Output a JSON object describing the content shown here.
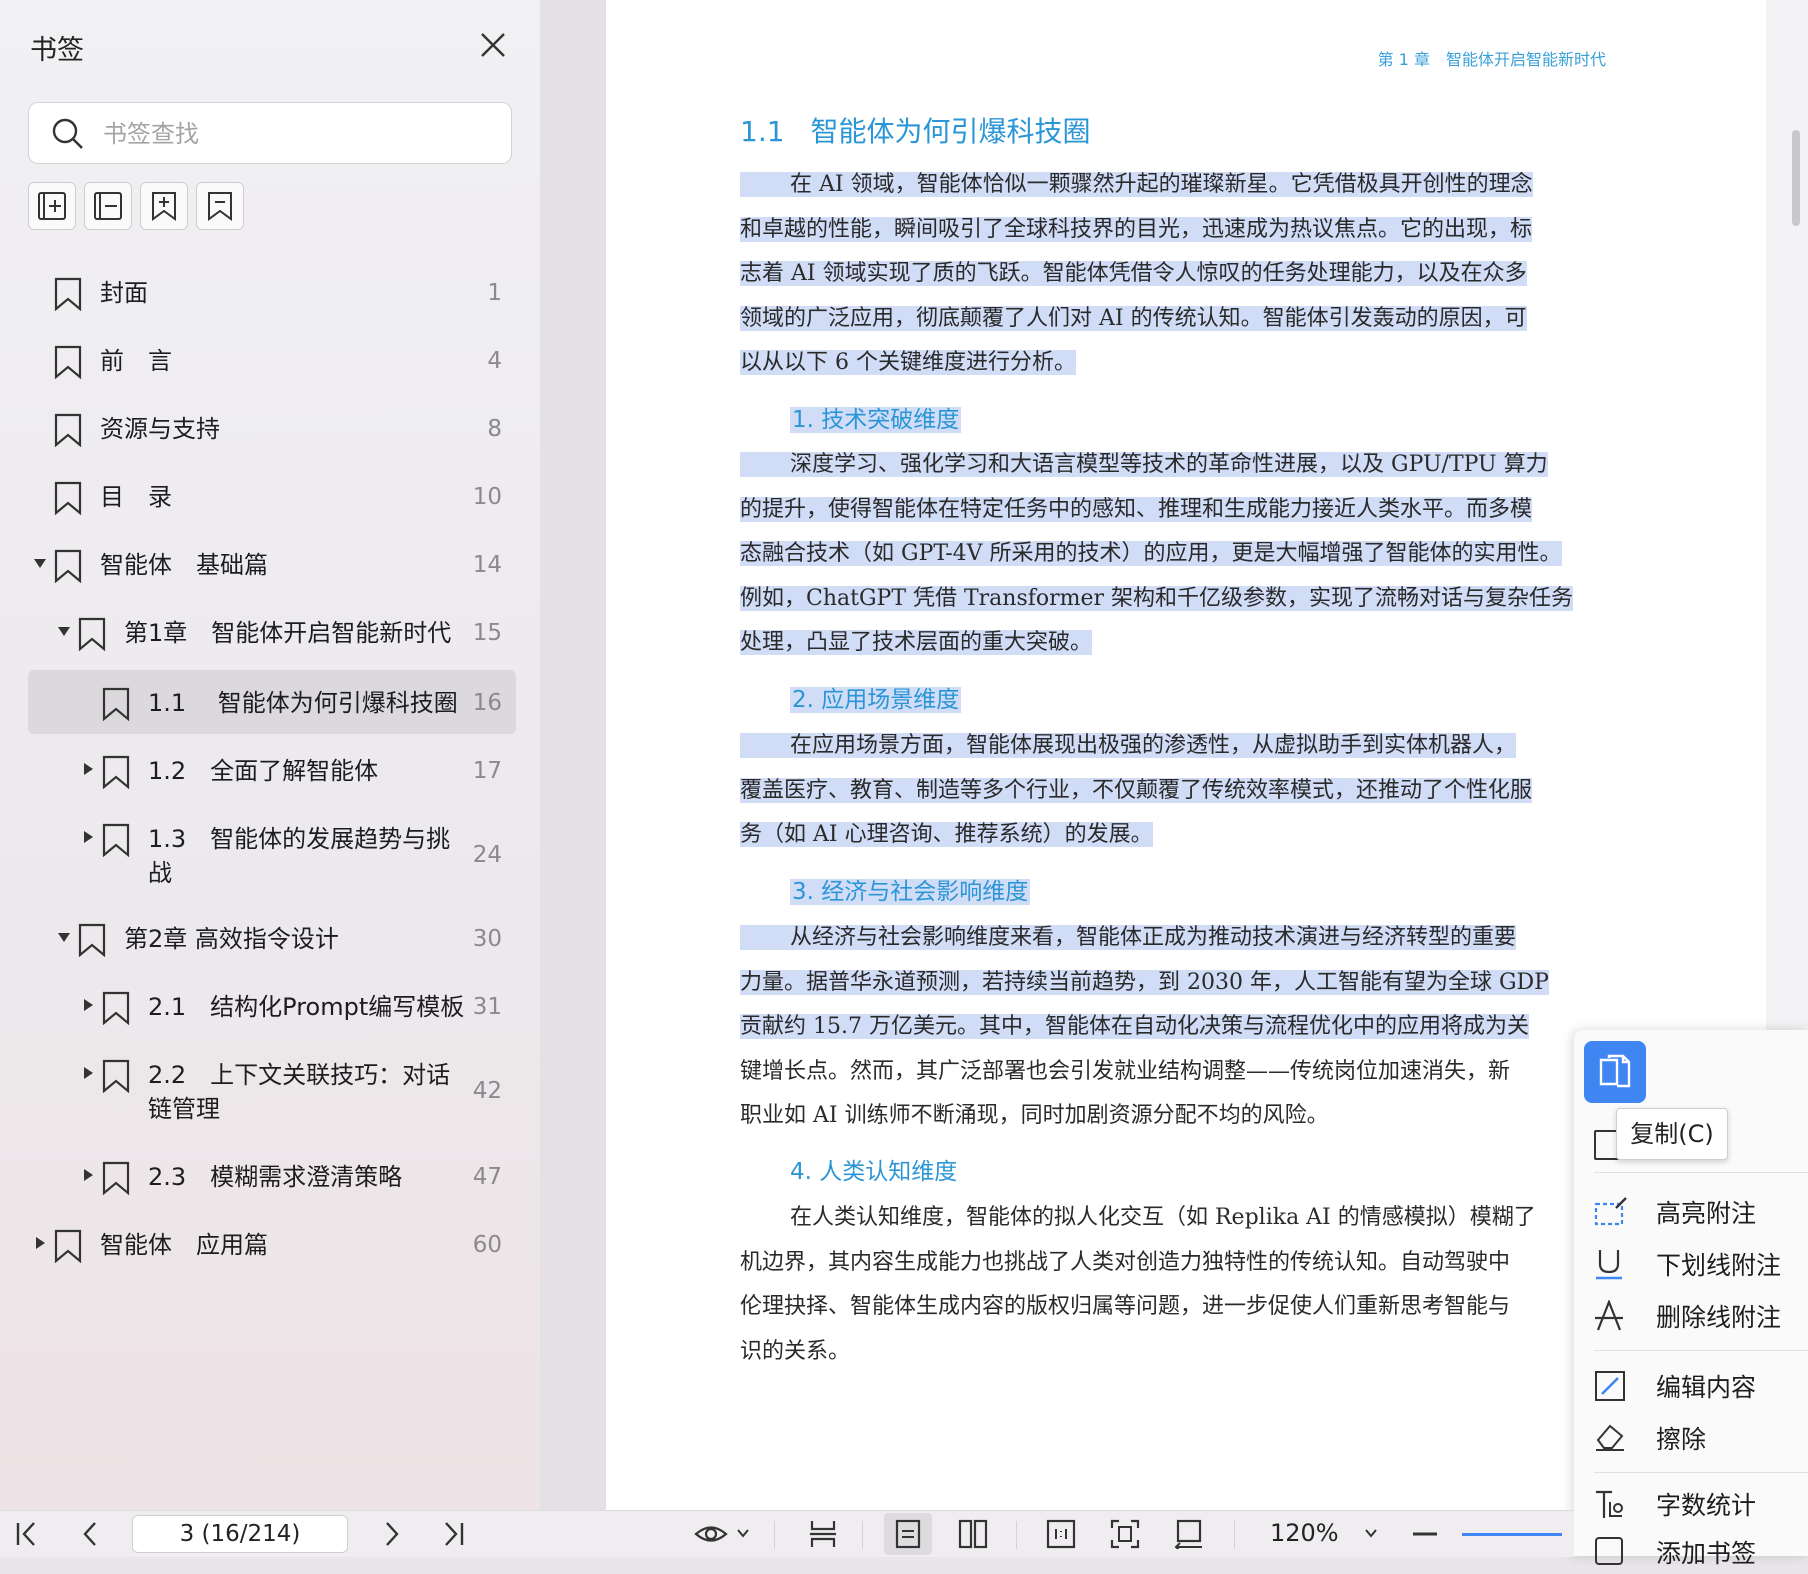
{
  "sidebar": {
    "title": "书签",
    "search_placeholder": "书签查找",
    "bookmarks": [
      {
        "label": "封面",
        "page": "1"
      },
      {
        "label": "前　言",
        "page": "4"
      },
      {
        "label": "资源与支持",
        "page": "8"
      },
      {
        "label": "目　录",
        "page": "10"
      },
      {
        "label": "智能体　基础篇",
        "page": "14"
      },
      {
        "label": "第1章　智能体开启智能新时代",
        "page": "15"
      },
      {
        "label": "1.1　 智能体为何引爆科技圈",
        "page": "16"
      },
      {
        "label": "1.2　全面了解智能体",
        "page": "17"
      },
      {
        "label": "1.3　智能体的发展趋势与挑",
        "label2": "战",
        "page": "24"
      },
      {
        "label": "第2章 高效指令设计",
        "page": "30"
      },
      {
        "label": "2.1　结构化Prompt编写模板",
        "page": "31"
      },
      {
        "label": "2.2　上下文关联技巧：对话",
        "label2": "链管理",
        "page": "42"
      },
      {
        "label": "2.3　模糊需求澄清策略",
        "page": "47"
      },
      {
        "label": "智能体　应用篇",
        "page": "60"
      }
    ]
  },
  "document": {
    "running_head": "第 1 章　智能体开启智能新时代",
    "section_number": "1.1",
    "section_title": "智能体为何引爆科技圈",
    "intro": [
      "在 AI 领域，智能体恰似一颗骤然升起的璀璨新星。它凭借极具开创性的理念",
      "和卓越的性能，瞬间吸引了全球科技界的目光，迅速成为热议焦点。它的出现，标",
      "志着 AI 领域实现了质的飞跃。智能体凭借令人惊叹的任务处理能力，以及在众多",
      "领域的广泛应用，彻底颠覆了人们对 AI 的传统认知。智能体引发轰动的原因，可",
      "以从以下 6 个关键维度进行分析。"
    ],
    "sub1": "1.  技术突破维度",
    "p1": [
      "深度学习、强化学习和大语言模型等技术的革命性进展，以及 GPU/TPU 算力",
      "的提升，使得智能体在特定任务中的感知、推理和生成能力接近人类水平。而多模",
      "态融合技术（如 GPT-4V 所采用的技术）的应用，更是大幅增强了智能体的实用性。",
      "例如，ChatGPT 凭借 Transformer 架构和千亿级参数，实现了流畅对话与复杂任务",
      "处理，凸显了技术层面的重大突破。"
    ],
    "sub2": "2.  应用场景维度",
    "p2": [
      "在应用场景方面，智能体展现出极强的渗透性，从虚拟助手到实体机器人，",
      "覆盖医疗、教育、制造等多个行业，不仅颠覆了传统效率模式，还推动了个性化服",
      "务（如 AI 心理咨询、推荐系统）的发展。"
    ],
    "sub3": "3.  经济与社会影响维度",
    "p3": [
      "从经济与社会影响维度来看，智能体正成为推动技术演进与经济转型的重要",
      "力量。据普华永道预测，若持续当前趋势，到 2030 年，人工智能有望为全球 GDP",
      "贡献约 15.7 万亿美元。其中，智能体在自动化决策与流程优化中的应用将成为关",
      "键增长点。然而，其广泛部署也会引发就业结构调整——传统岗位加速消失，新",
      "职业如 AI 训练师不断涌现，同时加剧资源分配不均的风险。"
    ],
    "sub4": "4.  人类认知维度",
    "p4": [
      "在人类认知维度，智能体的拟人化交互（如 Replika AI 的情感模拟）模糊了",
      "机边界，其内容生成能力也挑战了人类对创造力独特性的传统认知。自动驾驶中",
      "伦理抉择、智能体生成内容的版权归属等问题，进一步促使人们重新思考智能与",
      "识的关系。"
    ]
  },
  "context_menu": {
    "copy_tooltip": "复制(C)",
    "items": [
      {
        "label": "高亮附注"
      },
      {
        "label": "下划线附注"
      },
      {
        "label": "删除线附注"
      },
      {
        "label": "编辑内容"
      },
      {
        "label": "擦除"
      },
      {
        "label": "字数统计"
      },
      {
        "label": "添加书签"
      }
    ]
  },
  "toolbar": {
    "page_indicator": "3 (16/214)",
    "zoom": "120%"
  },
  "colors": {
    "accent": "#2b96d6",
    "selection": "#d1dcf7",
    "copy_button": "#3f86f2"
  }
}
